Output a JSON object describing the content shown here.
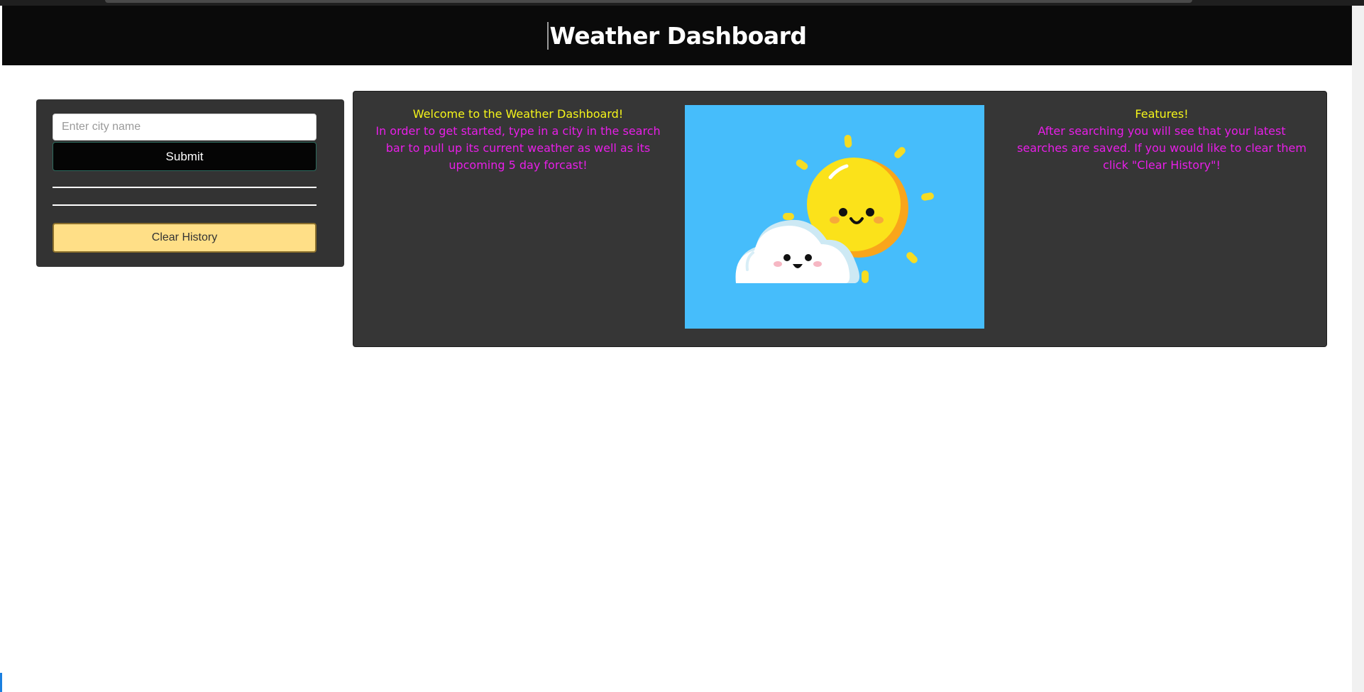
{
  "header": {
    "title": "Weather Dashboard"
  },
  "search": {
    "placeholder": "Enter city name",
    "value": "",
    "submit_label": "Submit",
    "clear_label": "Clear History"
  },
  "welcome": {
    "title": "Welcome to the Weather Dashboard!",
    "body": "In order to get started, type in a city in the search bar to pull up its current weather as well as its upcoming 5 day forcast!"
  },
  "features": {
    "title": "Features!",
    "body": "After searching you will see that your latest searches are saved. If you would like to clear them click \"Clear History\"!"
  },
  "colors": {
    "header_bg": "#0a0a0a",
    "panel_bg": "#333333",
    "title_yellow": "#f5f51a",
    "body_magenta": "#e81ee8",
    "clear_button": "#ffdf87",
    "image_sky": "#46bdfb"
  },
  "image": {
    "icon": "sun-cloud-illustration"
  }
}
